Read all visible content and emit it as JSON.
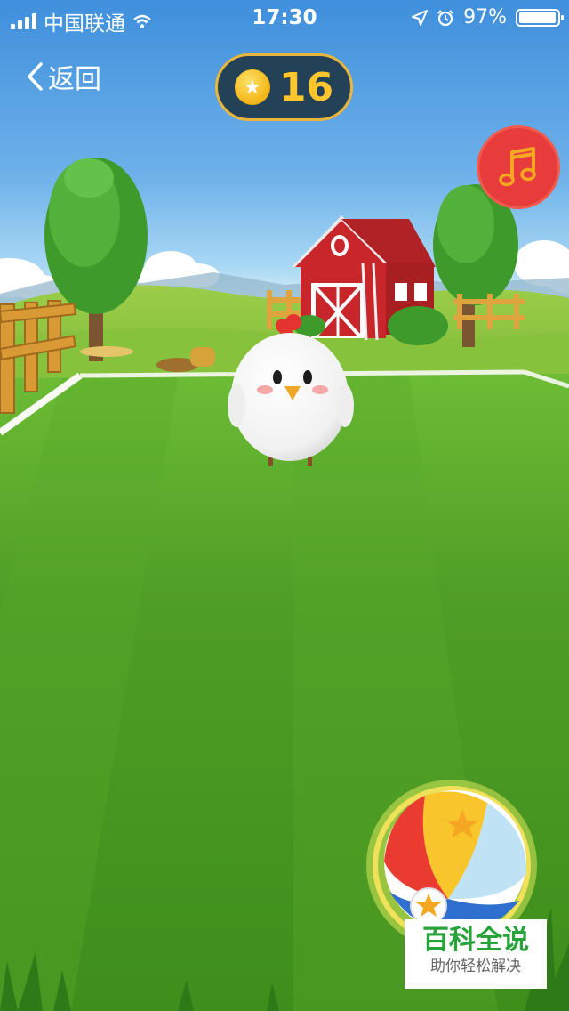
{
  "status_bar": {
    "carrier": "中国联通",
    "time": "17:30",
    "battery_percent": "97%",
    "battery_level": 0.97,
    "icons": [
      "signal-icon",
      "wifi-icon",
      "location-arrow-icon",
      "alarm-icon",
      "battery-icon"
    ]
  },
  "nav": {
    "back_label": "返回"
  },
  "hud": {
    "coin_count": "16",
    "coin_icon": "star-coin-icon",
    "music_icon": "music-note-icon"
  },
  "action": {
    "ball_icon": "beach-ball-icon"
  },
  "watermark": {
    "title": "百科全说",
    "subtitle": "助你轻松解决"
  },
  "colors": {
    "sky": "#4a96df",
    "grass": "#4f9e2a",
    "coin_badge_bg": "#244257",
    "coin_badge_border": "#e9b53a",
    "coin_text": "#ffc52c",
    "music_button": "#e83c3c",
    "barn_red": "#c8262a",
    "ball_ring": "#f0e15a",
    "watermark_green": "#27a33a"
  }
}
